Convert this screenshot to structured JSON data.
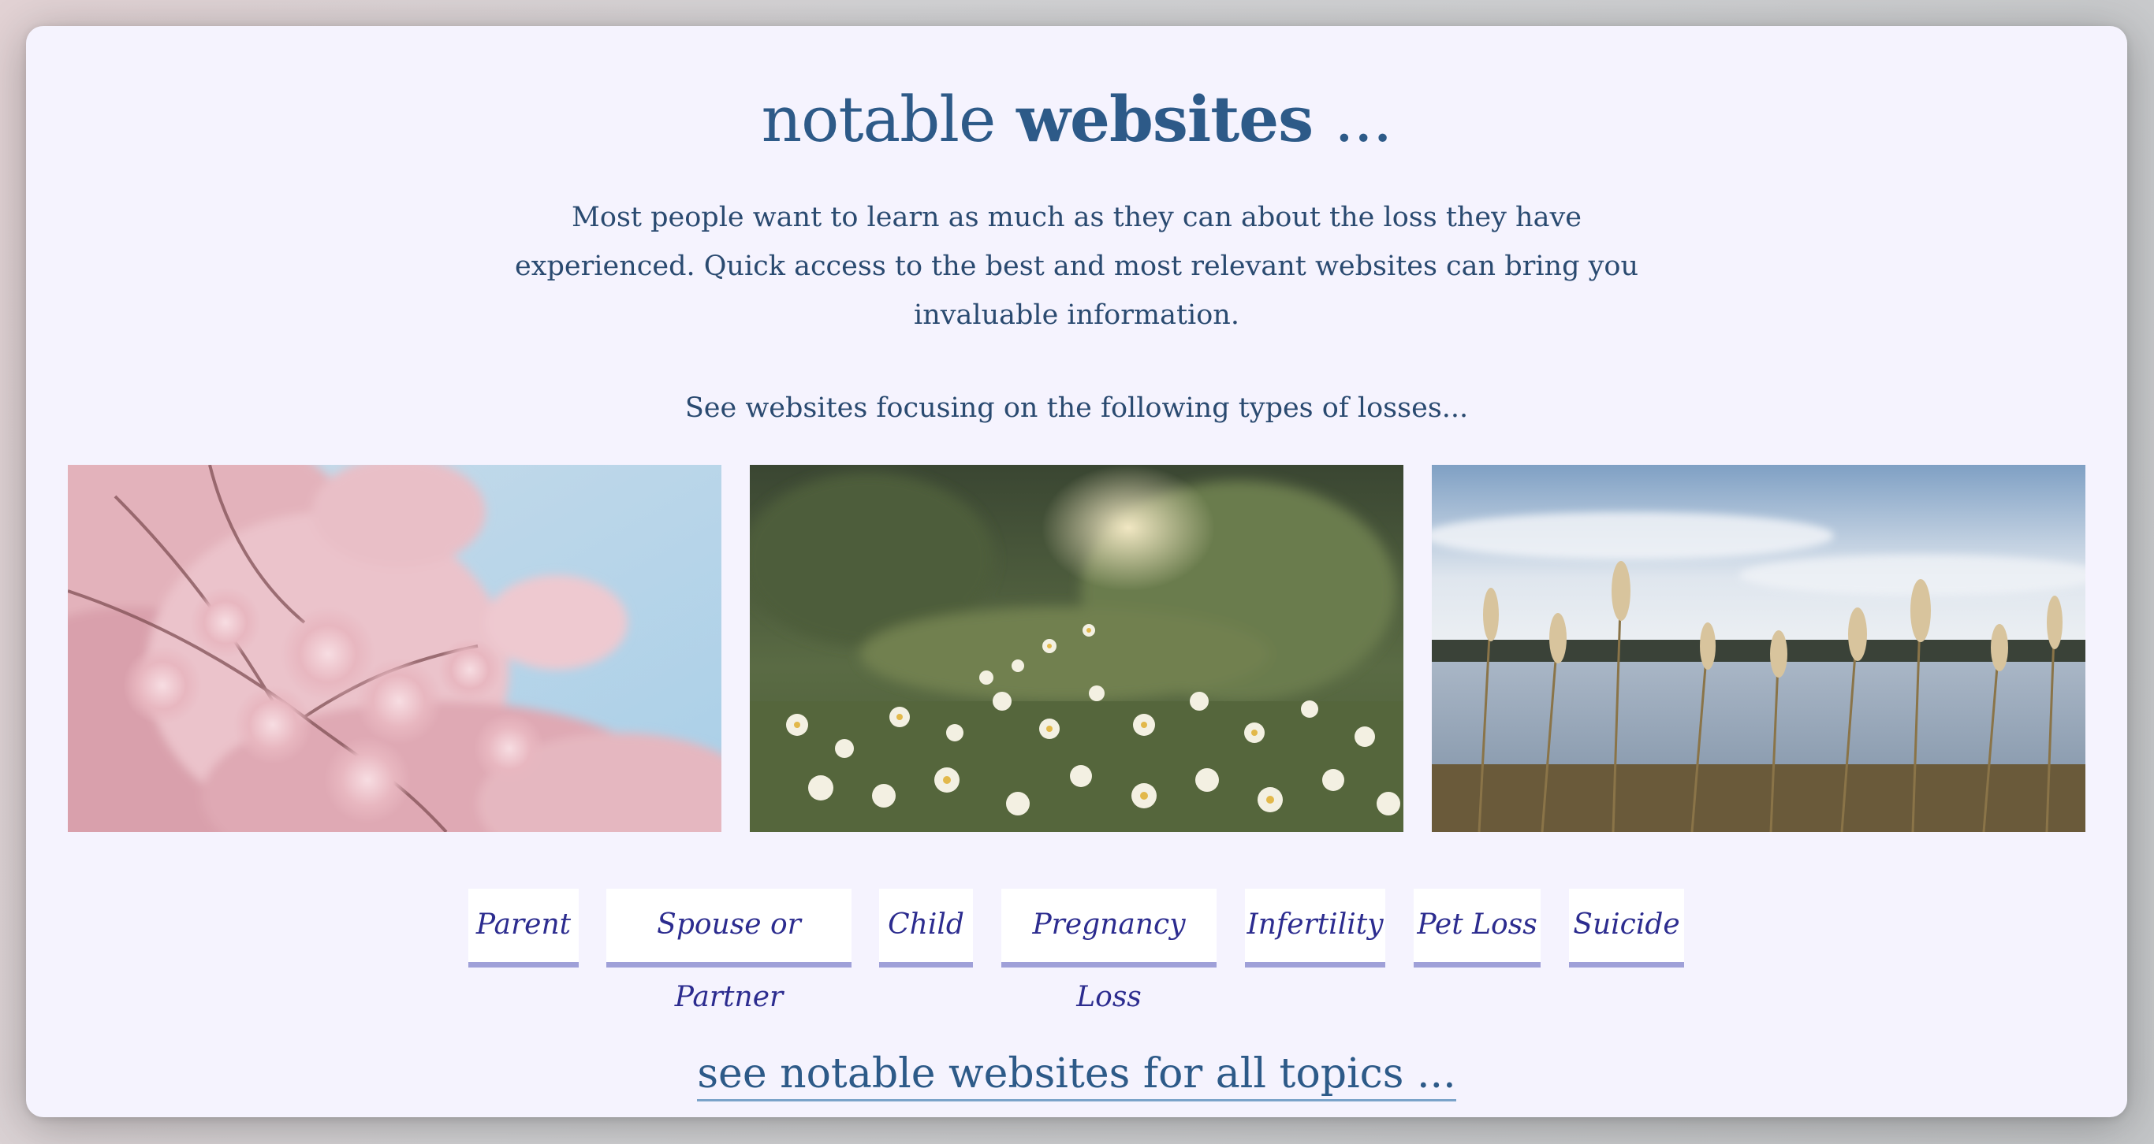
{
  "header": {
    "title_light": "notable",
    "title_bold": "websites",
    "title_suffix": "..."
  },
  "intro": {
    "paragraph": "Most people want to learn as much as they can about the loss they have experienced. Quick access to the best and most relevant websites can bring you invaluable information.",
    "prompt": "See websites focusing on the following types of losses..."
  },
  "gallery": {
    "images": [
      {
        "name": "cherry-blossom-photo"
      },
      {
        "name": "daisy-field-photo"
      },
      {
        "name": "lake-reeds-photo"
      }
    ]
  },
  "loss_types": [
    "Parent",
    "Spouse or Partner",
    "Child",
    "Pregnancy Loss",
    "Infertility",
    "Pet Loss",
    "Suicide"
  ],
  "footer": {
    "see_all_label": "see notable websites for all topics ..."
  },
  "colors": {
    "card_background": "#f5f3fe",
    "heading": "#2d5a88",
    "tag_text": "#2c2c8f",
    "tag_underline": "#9fa0d8"
  }
}
